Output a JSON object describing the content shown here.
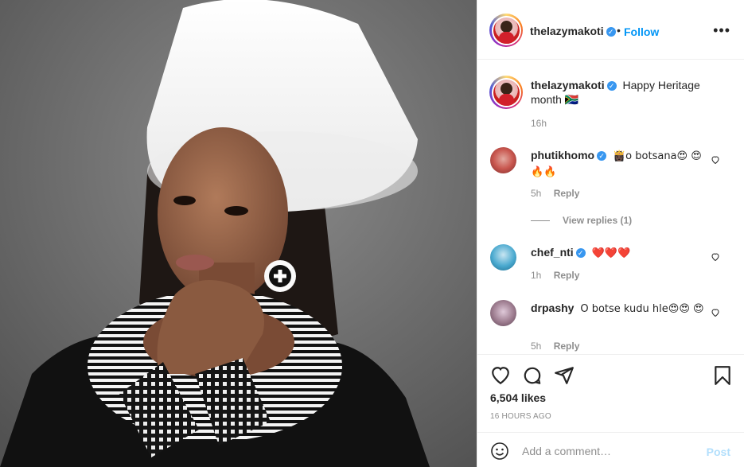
{
  "post": {
    "username": "thelazymakoti",
    "verified": true,
    "follow_label": "Follow",
    "separator": "•",
    "more_icon": "more-options-icon",
    "caption_text": "Happy Heritage month 🇿🇦",
    "caption_time": "16h"
  },
  "comments": [
    {
      "username": "phutikhomo",
      "verified": true,
      "text": "👸🏿o botsana😍 😍🔥🔥",
      "time": "5h",
      "reply_label": "Reply"
    },
    {
      "username": "chef_nti",
      "verified": true,
      "text": "❤️❤️❤️",
      "time": "1h",
      "reply_label": "Reply"
    },
    {
      "username": "drpashy",
      "verified": false,
      "text": "O botse kudu hle😍😍 😍",
      "time": "5h",
      "reply_label": "Reply"
    }
  ],
  "view_replies_label": "View replies (1)",
  "actions": {
    "like_icon": "heart-icon",
    "comment_icon": "comment-icon",
    "share_icon": "share-icon",
    "save_icon": "bookmark-icon",
    "likes": "6,504 likes",
    "time_ago": "16 HOURS AGO"
  },
  "add_comment": {
    "placeholder": "Add a comment…",
    "post_label": "Post",
    "emoji_icon": "smiley-icon"
  },
  "colors": {
    "accent": "#0095f6",
    "verified": "#3897f0",
    "muted": "#8e8e8e",
    "post_disabled": "#b2dffc"
  }
}
